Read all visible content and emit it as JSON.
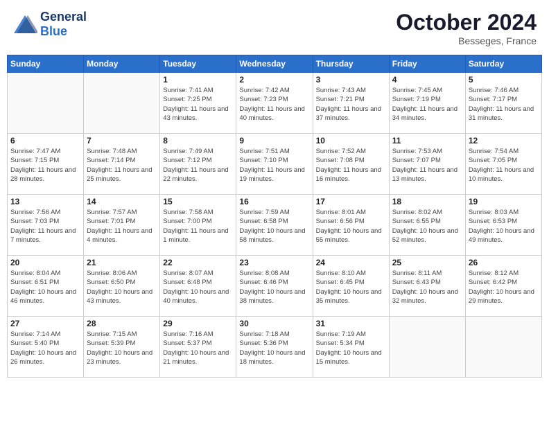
{
  "header": {
    "logo_general": "General",
    "logo_blue": "Blue",
    "month": "October 2024",
    "location": "Besseges, France"
  },
  "weekdays": [
    "Sunday",
    "Monday",
    "Tuesday",
    "Wednesday",
    "Thursday",
    "Friday",
    "Saturday"
  ],
  "weeks": [
    [
      {
        "day": "",
        "info": ""
      },
      {
        "day": "",
        "info": ""
      },
      {
        "day": "1",
        "info": "Sunrise: 7:41 AM\nSunset: 7:25 PM\nDaylight: 11 hours and 43 minutes."
      },
      {
        "day": "2",
        "info": "Sunrise: 7:42 AM\nSunset: 7:23 PM\nDaylight: 11 hours and 40 minutes."
      },
      {
        "day": "3",
        "info": "Sunrise: 7:43 AM\nSunset: 7:21 PM\nDaylight: 11 hours and 37 minutes."
      },
      {
        "day": "4",
        "info": "Sunrise: 7:45 AM\nSunset: 7:19 PM\nDaylight: 11 hours and 34 minutes."
      },
      {
        "day": "5",
        "info": "Sunrise: 7:46 AM\nSunset: 7:17 PM\nDaylight: 11 hours and 31 minutes."
      }
    ],
    [
      {
        "day": "6",
        "info": "Sunrise: 7:47 AM\nSunset: 7:15 PM\nDaylight: 11 hours and 28 minutes."
      },
      {
        "day": "7",
        "info": "Sunrise: 7:48 AM\nSunset: 7:14 PM\nDaylight: 11 hours and 25 minutes."
      },
      {
        "day": "8",
        "info": "Sunrise: 7:49 AM\nSunset: 7:12 PM\nDaylight: 11 hours and 22 minutes."
      },
      {
        "day": "9",
        "info": "Sunrise: 7:51 AM\nSunset: 7:10 PM\nDaylight: 11 hours and 19 minutes."
      },
      {
        "day": "10",
        "info": "Sunrise: 7:52 AM\nSunset: 7:08 PM\nDaylight: 11 hours and 16 minutes."
      },
      {
        "day": "11",
        "info": "Sunrise: 7:53 AM\nSunset: 7:07 PM\nDaylight: 11 hours and 13 minutes."
      },
      {
        "day": "12",
        "info": "Sunrise: 7:54 AM\nSunset: 7:05 PM\nDaylight: 11 hours and 10 minutes."
      }
    ],
    [
      {
        "day": "13",
        "info": "Sunrise: 7:56 AM\nSunset: 7:03 PM\nDaylight: 11 hours and 7 minutes."
      },
      {
        "day": "14",
        "info": "Sunrise: 7:57 AM\nSunset: 7:01 PM\nDaylight: 11 hours and 4 minutes."
      },
      {
        "day": "15",
        "info": "Sunrise: 7:58 AM\nSunset: 7:00 PM\nDaylight: 11 hours and 1 minute."
      },
      {
        "day": "16",
        "info": "Sunrise: 7:59 AM\nSunset: 6:58 PM\nDaylight: 10 hours and 58 minutes."
      },
      {
        "day": "17",
        "info": "Sunrise: 8:01 AM\nSunset: 6:56 PM\nDaylight: 10 hours and 55 minutes."
      },
      {
        "day": "18",
        "info": "Sunrise: 8:02 AM\nSunset: 6:55 PM\nDaylight: 10 hours and 52 minutes."
      },
      {
        "day": "19",
        "info": "Sunrise: 8:03 AM\nSunset: 6:53 PM\nDaylight: 10 hours and 49 minutes."
      }
    ],
    [
      {
        "day": "20",
        "info": "Sunrise: 8:04 AM\nSunset: 6:51 PM\nDaylight: 10 hours and 46 minutes."
      },
      {
        "day": "21",
        "info": "Sunrise: 8:06 AM\nSunset: 6:50 PM\nDaylight: 10 hours and 43 minutes."
      },
      {
        "day": "22",
        "info": "Sunrise: 8:07 AM\nSunset: 6:48 PM\nDaylight: 10 hours and 40 minutes."
      },
      {
        "day": "23",
        "info": "Sunrise: 8:08 AM\nSunset: 6:46 PM\nDaylight: 10 hours and 38 minutes."
      },
      {
        "day": "24",
        "info": "Sunrise: 8:10 AM\nSunset: 6:45 PM\nDaylight: 10 hours and 35 minutes."
      },
      {
        "day": "25",
        "info": "Sunrise: 8:11 AM\nSunset: 6:43 PM\nDaylight: 10 hours and 32 minutes."
      },
      {
        "day": "26",
        "info": "Sunrise: 8:12 AM\nSunset: 6:42 PM\nDaylight: 10 hours and 29 minutes."
      }
    ],
    [
      {
        "day": "27",
        "info": "Sunrise: 7:14 AM\nSunset: 5:40 PM\nDaylight: 10 hours and 26 minutes."
      },
      {
        "day": "28",
        "info": "Sunrise: 7:15 AM\nSunset: 5:39 PM\nDaylight: 10 hours and 23 minutes."
      },
      {
        "day": "29",
        "info": "Sunrise: 7:16 AM\nSunset: 5:37 PM\nDaylight: 10 hours and 21 minutes."
      },
      {
        "day": "30",
        "info": "Sunrise: 7:18 AM\nSunset: 5:36 PM\nDaylight: 10 hours and 18 minutes."
      },
      {
        "day": "31",
        "info": "Sunrise: 7:19 AM\nSunset: 5:34 PM\nDaylight: 10 hours and 15 minutes."
      },
      {
        "day": "",
        "info": ""
      },
      {
        "day": "",
        "info": ""
      }
    ]
  ]
}
